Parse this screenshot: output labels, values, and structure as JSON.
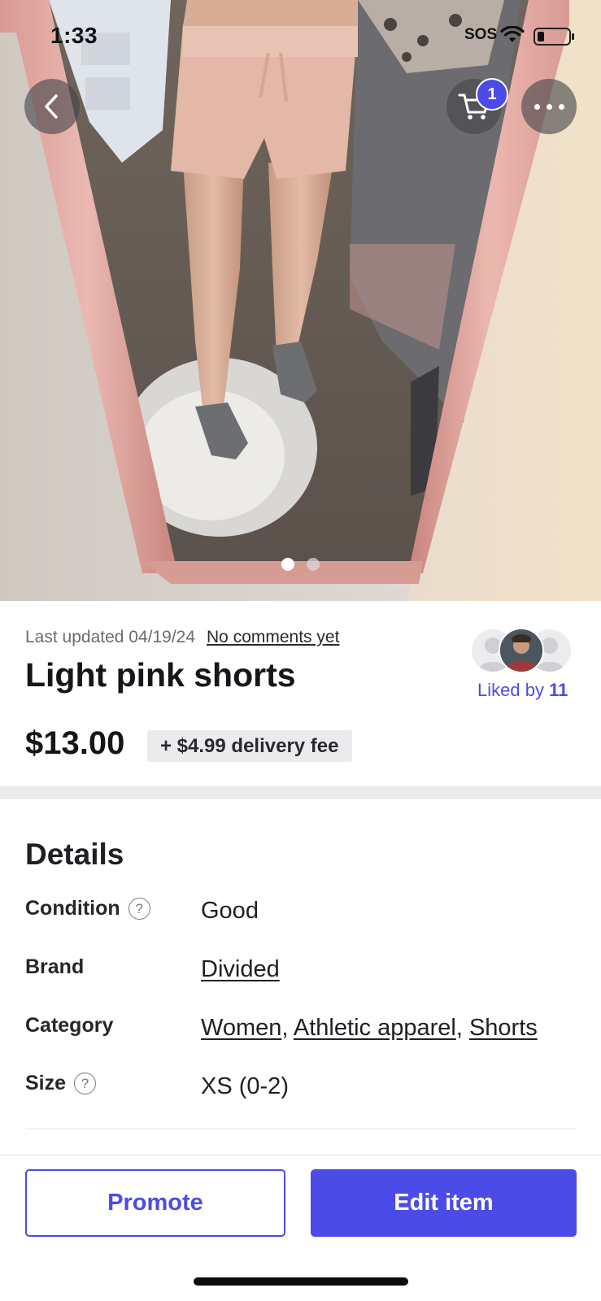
{
  "status_bar": {
    "time": "1:33",
    "carrier": "SOS",
    "icons": [
      "wifi-icon",
      "battery-low-icon"
    ]
  },
  "top_nav": {
    "back_icon": "chevron-left-icon",
    "cart_icon": "cart-icon",
    "cart_count": "1",
    "more_icon": "more-horizontal-icon"
  },
  "gallery": {
    "image_count": 2,
    "active_index": 0
  },
  "listing": {
    "last_updated": "Last updated 04/19/24",
    "comments_link": "No comments yet",
    "title": "Light pink shorts",
    "price": "$13.00",
    "delivery_fee": "+ $4.99 delivery fee",
    "liked_by_label": "Liked by",
    "liked_by_count": "11"
  },
  "details": {
    "heading": "Details",
    "rows": [
      {
        "label": "Condition",
        "has_help": true,
        "value": "Good"
      },
      {
        "label": "Brand",
        "has_help": false,
        "value": "Divided"
      },
      {
        "label": "Category",
        "has_help": false,
        "values": [
          "Women",
          "Athletic apparel",
          "Shorts"
        ],
        "separator": ", "
      },
      {
        "label": "Size",
        "has_help": true,
        "value": "XS (0-2)"
      }
    ]
  },
  "actions": {
    "promote": "Promote",
    "edit": "Edit item"
  },
  "colors": {
    "accent": "#4b4be8",
    "text": "#1f1f24",
    "muted": "#6b6b70",
    "band": "#ebebee"
  }
}
